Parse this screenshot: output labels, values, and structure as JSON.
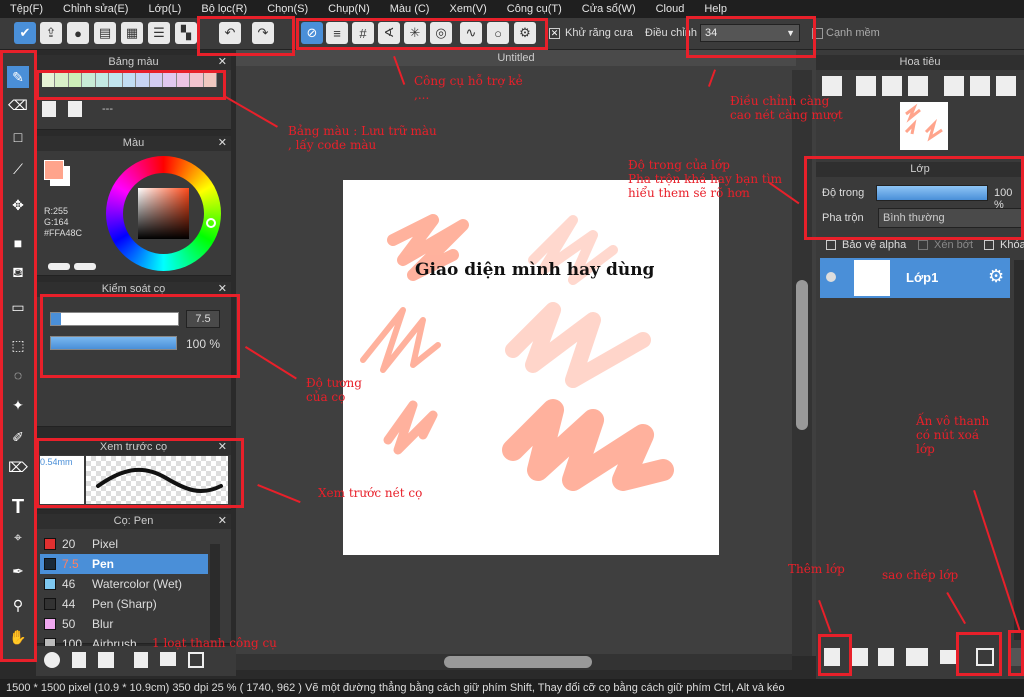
{
  "menu": [
    "Tệp(F)",
    "Chỉnh sửa(E)",
    "Lớp(L)",
    "Bộ lọc(R)",
    "Chọn(S)",
    "Chụp(N)",
    "Màu (C)",
    "Xem(V)",
    "Công cụ(T)",
    "Cửa sổ(W)",
    "Cloud",
    "Help"
  ],
  "toolbar": {
    "antialias_label": "Khử răng cưa",
    "adjust_label": "Điều chỉnh",
    "adjust_value": "34",
    "soft_edge_label": "Cạnh mềm"
  },
  "palette": {
    "title": "Bảng màu",
    "swatches": [
      "#e6f3d6",
      "#d9f0c8",
      "#cdeeb8",
      "#c8ecd6",
      "#c3e9e3",
      "#c1e5ef",
      "#c2ddf3",
      "#c8d4f3",
      "#d3ccf2",
      "#e1c8ef",
      "#ecc4e4",
      "#f2c3cf",
      "#f0c8c0"
    ],
    "name_field": "---"
  },
  "color": {
    "title": "Màu",
    "foreground": "#FFA48C",
    "r": "R:255",
    "g": "G:164",
    "hex": "#FFA48C"
  },
  "brush_control": {
    "title": "Kiểm soát cọ",
    "size_value": "7.5",
    "opacity_value": "100 %",
    "size_fill": 0.08,
    "opacity_fill": 1.0
  },
  "preview": {
    "title": "Xem trước cọ",
    "size_text": "0.54mm"
  },
  "brush_list": {
    "title": "Cọ: Pen",
    "items": [
      {
        "color": "#e03030",
        "size": "20",
        "name": "Pixel",
        "selected": false
      },
      {
        "color": "#1a2a3a",
        "size": "7.5",
        "name": "Pen",
        "selected": true
      },
      {
        "color": "#7ec8f0",
        "size": "46",
        "name": "Watercolor (Wet)",
        "selected": false
      },
      {
        "color": "#333333",
        "size": "44",
        "name": "Pen (Sharp)",
        "selected": false
      },
      {
        "color": "#f0a8f0",
        "size": "50",
        "name": "Blur",
        "selected": false
      },
      {
        "color": "#bbbbbb",
        "size": "100",
        "name": "Airbrush",
        "selected": false
      }
    ]
  },
  "canvas": {
    "tab_title": "Untitled",
    "caption": "Giao diện mình hay dùng"
  },
  "navigator": {
    "title": "Hoa tiêu"
  },
  "layers": {
    "title": "Lớp",
    "opacity_label": "Độ trong",
    "opacity_value": "100 %",
    "blend_label": "Pha trộn",
    "blend_value": "Bình thường",
    "protect_alpha": "Bảo vệ alpha",
    "clipping": "Xén bớt",
    "lock": "Khóa",
    "layer_name": "Lớp1"
  },
  "annotations": {
    "support_tools": "Công cụ hỗ trợ kẻ\n,...",
    "adjust": "Điều chỉnh càng\ncao nét càng mượt",
    "palette": "Bảng màu : Lưu trữ màu\n, lấy code màu",
    "layer_opacity": "Độ trong của lớp\nPha trộn khá hay bạn tìm\nhiểu them sẽ rõ hơn",
    "brush_opacity": "Độ tương\ncủa cọ",
    "preview": "Xem trước nét cọ",
    "toolbar": "1 loạt thanh công cụ",
    "delete": "Ấn vô thanh\ncó nút xoá\nlớp",
    "add_layer": "Thêm lớp",
    "copy_layer": "sao chép lớp"
  },
  "status": {
    "text": "1500 * 1500 pixel  (10.9 * 10.9cm)  350 dpi  25 %  ( 1740, 962 )  Vẽ một đường thẳng bằng cách giữ phím Shift, Thay đổi cỡ cọ bằng cách giữ phím Ctrl, Alt và kéo"
  },
  "colors": {
    "accent": "#e8202a",
    "brush": "#FFA48C",
    "selection": "#4a8fd8"
  }
}
